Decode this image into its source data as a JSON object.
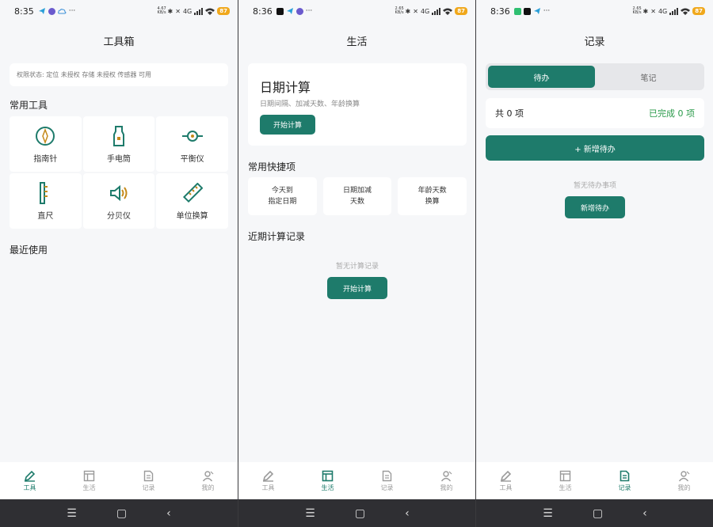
{
  "phones": [
    {
      "status": {
        "time": "8:35",
        "netspeed": "4.67\nKB/s",
        "signal_label": "4G",
        "battery": "87"
      },
      "title": "工具箱",
      "permissions": "权限状态: 定位 未授权  存储 未授权  传感器 可用",
      "common_tools_title": "常用工具",
      "tools": [
        {
          "label": "指南针",
          "icon": "compass-icon"
        },
        {
          "label": "手电筒",
          "icon": "flashlight-icon"
        },
        {
          "label": "平衡仪",
          "icon": "level-icon"
        },
        {
          "label": "直尺",
          "icon": "ruler-icon"
        },
        {
          "label": "分贝仪",
          "icon": "decibel-icon"
        },
        {
          "label": "单位换算",
          "icon": "unit-convert-icon"
        }
      ],
      "recent_title": "最近使用",
      "active_tab": 0
    },
    {
      "status": {
        "time": "8:36",
        "netspeed": "2.65\nKB/s",
        "signal_label": "4G",
        "battery": "87"
      },
      "title": "生活",
      "date_card": {
        "title": "日期计算",
        "subtitle": "日期间隔、加减天数、年龄换算",
        "button": "开始计算"
      },
      "quick_title": "常用快捷项",
      "quick_items": [
        "今天到\n指定日期",
        "日期加减\n天数",
        "年龄天数\n换算"
      ],
      "recent_title": "近期计算记录",
      "empty_text": "暂无计算记录",
      "empty_button": "开始计算",
      "active_tab": 1
    },
    {
      "status": {
        "time": "8:36",
        "netspeed": "2.65\nKB/s",
        "signal_label": "4G",
        "battery": "87"
      },
      "title": "记录",
      "segments": {
        "active": "待办",
        "inactive": "笔记"
      },
      "count_text": "共 0 项",
      "done_text": "已完成 0 项",
      "add_bar": "+ 新增待办",
      "empty_text": "暂无待办事项",
      "empty_button": "新增待办",
      "active_tab": 2
    }
  ],
  "nav": {
    "tabs": [
      "工具",
      "生活",
      "记录",
      "我的"
    ]
  },
  "colors": {
    "accent": "#1e7b6b",
    "done": "#2a9a4a",
    "battery": "#f0a81c"
  }
}
